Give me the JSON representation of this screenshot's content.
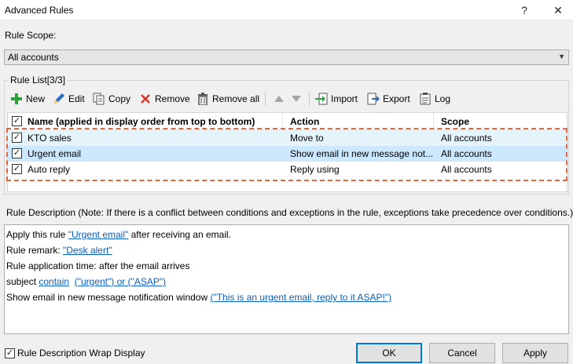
{
  "window": {
    "title": "Advanced Rules",
    "help_glyph": "?",
    "close_glyph": "✕"
  },
  "scope": {
    "label": "Rule Scope:",
    "value": "All accounts"
  },
  "rule_list": {
    "label": "Rule List[3/3]",
    "toolbar": {
      "new": "New",
      "edit": "Edit",
      "copy": "Copy",
      "remove": "Remove",
      "remove_all": "Remove all",
      "import": "Import",
      "export": "Export",
      "log": "Log"
    },
    "columns": {
      "name": "Name (applied in display order from top to bottom)",
      "action": "Action",
      "scope": "Scope"
    },
    "rows": [
      {
        "name": "KTO sales",
        "action": "Move to",
        "scope": "All accounts"
      },
      {
        "name": "Urgent email",
        "action": "Show email in new message not...",
        "scope": "All accounts"
      },
      {
        "name": "Auto reply",
        "action": "Reply using",
        "scope": "All accounts"
      }
    ]
  },
  "description": {
    "label": "Rule Description (Note: If there is a conflict between conditions and exceptions in the rule, exceptions take precedence over conditions.)",
    "line1": {
      "pre": "Apply this rule ",
      "link": "\"Urgent email\"",
      "post": " after receiving an email."
    },
    "line2": {
      "pre": "Rule remark: ",
      "link": "\"Desk alert\""
    },
    "line3": "Rule application time: after the email arrives",
    "line4": {
      "pre": "subject ",
      "link1": "contain",
      "link2": "(\"urgent\") or (\"ASAP\")"
    },
    "line5": {
      "pre": "Show email in new message notification window ",
      "link": "(\"This is an urgent email, reply to it ASAP!\")"
    }
  },
  "footer": {
    "wrap_label": "Rule Description Wrap Display",
    "ok": "OK",
    "cancel": "Cancel",
    "apply": "Apply"
  },
  "colors": {
    "accent": "#0078d7",
    "link": "#0a5ec4",
    "dash": "#e2663f",
    "selected_row": "#cce8ff"
  },
  "icons": [
    "plus-icon",
    "pencil-icon",
    "copy-icon",
    "x-icon",
    "trash-icon",
    "up-arrow-icon",
    "down-arrow-icon",
    "import-icon",
    "export-icon",
    "log-icon"
  ]
}
